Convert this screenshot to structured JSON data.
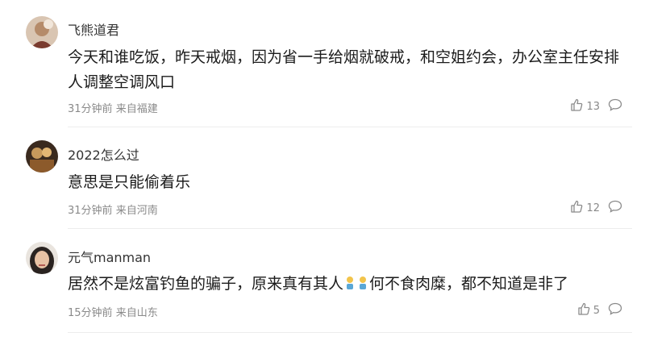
{
  "comments": [
    {
      "username": "飞熊道君",
      "text": "今天和谁吃饭，昨天戒烟，因为省一手给烟就破戒，和空姐约会，办公室主任安排人调整空调风口",
      "time": "31分钟前",
      "location": "来自福建",
      "likes": "13"
    },
    {
      "username": "2022怎么过",
      "text": "意思是只能偷着乐",
      "time": "31分钟前",
      "location": "来自河南",
      "likes": "12"
    },
    {
      "username": "元气manman",
      "text_before": "居然不是炫富钓鱼的骗子，原来真有其人",
      "text_after": "何不食肉糜，都不知道是非了",
      "time": "15分钟前",
      "location": "来自山东",
      "likes": "5"
    }
  ],
  "icons": {
    "like": "thumbs-up-icon",
    "reply": "comment-bubble-icon",
    "emoji": "person-emoji-icon"
  }
}
